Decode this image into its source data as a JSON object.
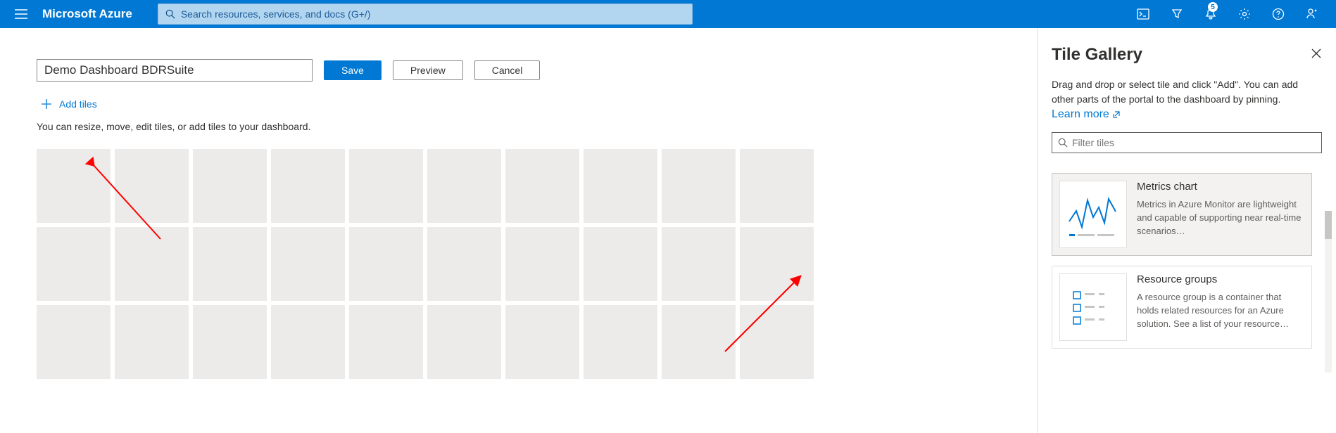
{
  "topbar": {
    "brand": "Microsoft Azure",
    "search_placeholder": "Search resources, services, and docs (G+/)",
    "notification_count": "5"
  },
  "dashboard": {
    "name_value": "Demo Dashboard BDRSuite",
    "save_label": "Save",
    "preview_label": "Preview",
    "cancel_label": "Cancel",
    "add_tiles_label": "Add tiles",
    "help_text": "You can resize, move, edit tiles, or add tiles to your dashboard."
  },
  "sidepanel": {
    "title": "Tile Gallery",
    "description": "Drag and drop or select tile and click \"Add\". You can add other parts of the portal to the dashboard by pinning.",
    "learn_more": "Learn more",
    "filter_placeholder": "Filter tiles",
    "tiles": [
      {
        "name": "Metrics chart",
        "desc": "Metrics in Azure Monitor are lightweight and capable of supporting near real-time scenarios…"
      },
      {
        "name": "Resource groups",
        "desc": "A resource group is a container that holds related resources for an Azure solution. See a list of your resource…"
      }
    ]
  }
}
